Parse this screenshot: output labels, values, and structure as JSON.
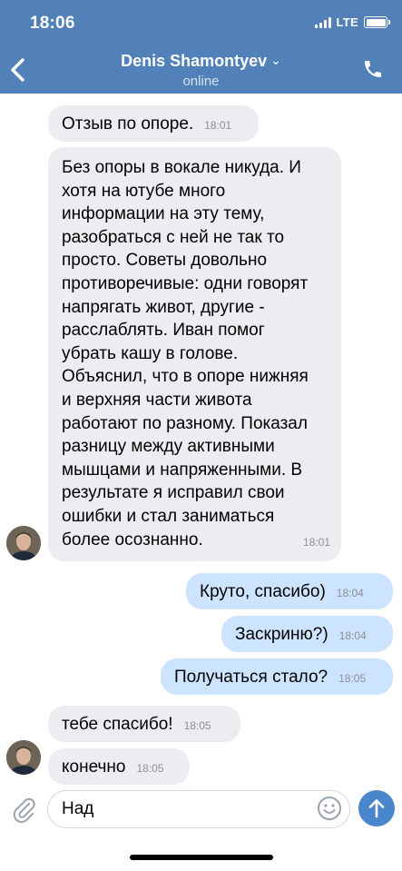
{
  "status_bar": {
    "time": "18:06",
    "network": "LTE"
  },
  "header": {
    "contact_name": "Denis Shamontyev",
    "status": "online"
  },
  "messages": [
    {
      "text": "Отзыв по опоре.",
      "time": "18:01"
    },
    {
      "lines": [
        "Без опоры в вокале никуда. И",
        "хотя на ютубе много",
        "информации на эту тему,",
        "разобраться с ней не так то",
        "просто. Советы довольно",
        "противоречивые: одни говорят",
        "напрягать живот, другие -",
        "расслаблять. Иван помог",
        "убрать кашу в голове.",
        "Объяснил, что в опоре нижняя",
        "и верхняя части живота",
        "работают по разному. Показал",
        "разницу между активными",
        "мышцами и напряженными. В",
        "результате я исправил свои",
        "ошибки и стал заниматься",
        "более осознанно."
      ],
      "time": "18:01"
    },
    {
      "text": "Круто, спасибо)",
      "time": "18:04"
    },
    {
      "text": "Заскриню?)",
      "time": "18:04"
    },
    {
      "text": "Получаться стало?",
      "time": "18:05"
    },
    {
      "text": "тебе спасибо!",
      "time": "18:05"
    },
    {
      "text": "конечно",
      "time": "18:05"
    }
  ],
  "composer": {
    "value": "Над"
  },
  "icons": {
    "back": "chevron-left-icon",
    "call": "phone-icon",
    "attach": "paperclip-icon",
    "emoji": "smiley-icon",
    "send": "arrow-up-icon"
  },
  "colors": {
    "header": "#5181b8",
    "incoming": "#ebedf0",
    "outgoing": "#cce4ff",
    "send": "#4986cc"
  }
}
